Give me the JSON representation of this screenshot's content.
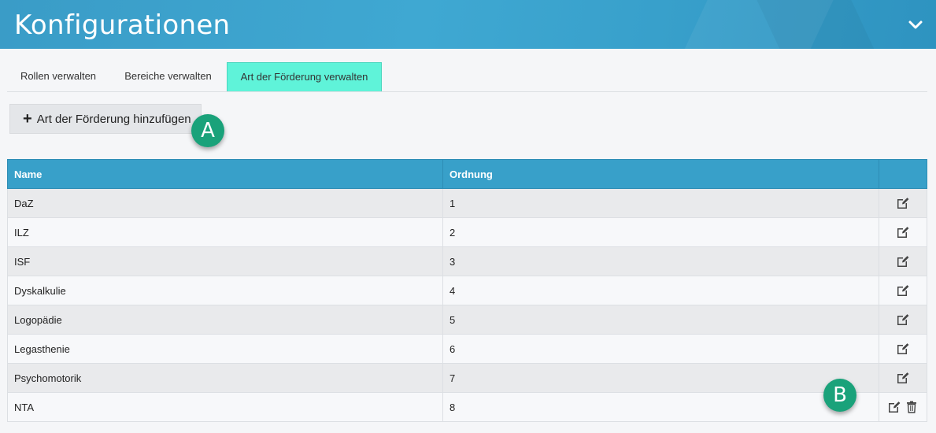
{
  "header": {
    "title": "Konfigurationen"
  },
  "tabs": [
    {
      "label": "Rollen verwalten",
      "active": false
    },
    {
      "label": "Bereiche verwalten",
      "active": false
    },
    {
      "label": "Art der Förderung verwalten",
      "active": true
    }
  ],
  "toolbar": {
    "add_label": "Art der Förderung hinzufügen"
  },
  "badges": {
    "a": "A",
    "b": "B"
  },
  "table": {
    "columns": {
      "name": "Name",
      "order": "Ordnung",
      "actions": ""
    },
    "rows": [
      {
        "name": "DaZ",
        "order": "1",
        "deletable": false
      },
      {
        "name": "ILZ",
        "order": "2",
        "deletable": false
      },
      {
        "name": "ISF",
        "order": "3",
        "deletable": false
      },
      {
        "name": "Dyskalkulie",
        "order": "4",
        "deletable": false
      },
      {
        "name": "Logopädie",
        "order": "5",
        "deletable": false
      },
      {
        "name": "Legasthenie",
        "order": "6",
        "deletable": false
      },
      {
        "name": "Psychomotorik",
        "order": "7",
        "deletable": false
      },
      {
        "name": "NTA",
        "order": "8",
        "deletable": true
      }
    ]
  },
  "colors": {
    "header": "#3ba2cc",
    "active_tab": "#5ff3d9",
    "badge": "#1aa27a"
  },
  "icons": {
    "collapse": "chevron-down-icon",
    "add": "plus-icon",
    "edit": "edit-icon",
    "delete": "trash-icon"
  }
}
